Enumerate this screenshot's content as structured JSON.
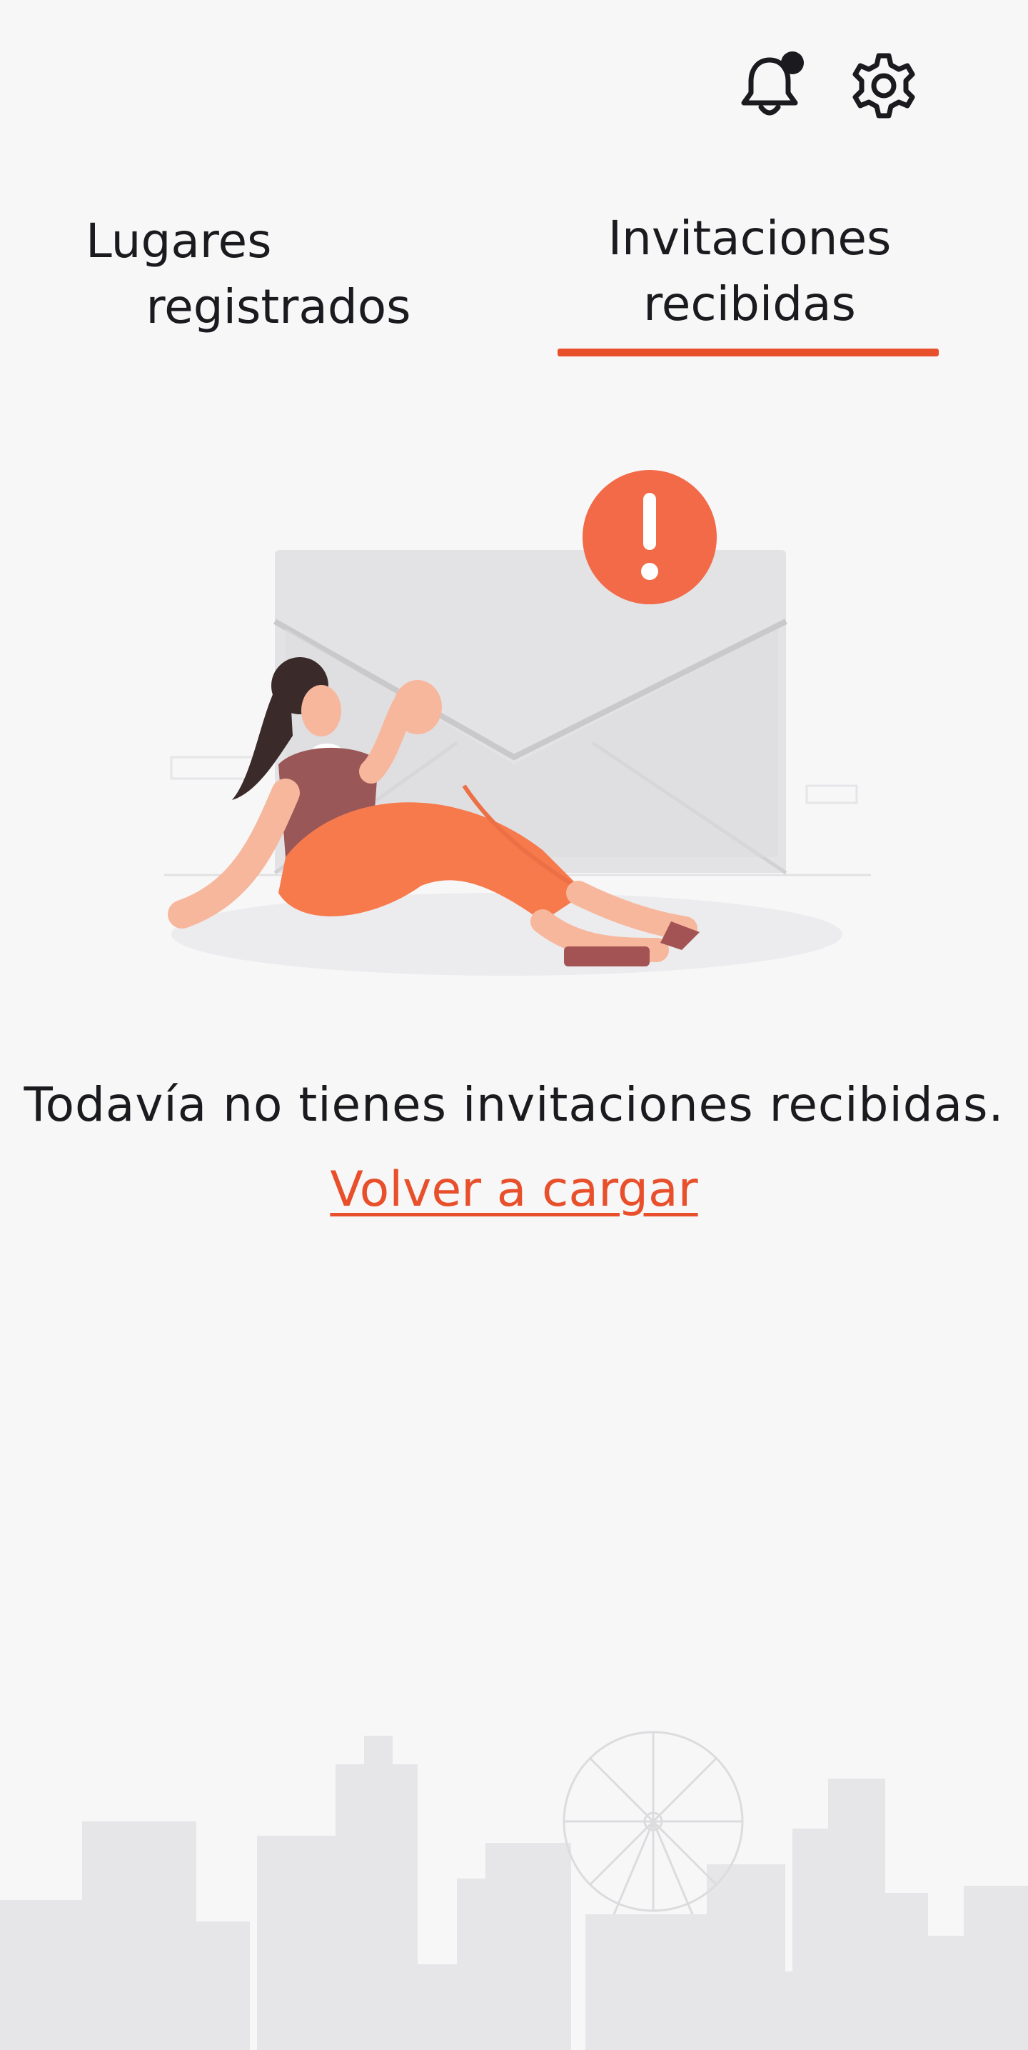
{
  "header": {
    "icons": [
      "notification-bell-icon",
      "gear-icon"
    ],
    "notification_dot": true
  },
  "tabs": [
    {
      "line1": "Lugares",
      "line2": "registrados",
      "active": false
    },
    {
      "line1": "Invitaciones",
      "line2": "recibidas",
      "active": true
    }
  ],
  "empty_state": {
    "illustration": "woman-sitting-with-envelope-alert-illustration",
    "message": "Todavía no tienes invitaciones recibidas.",
    "reload_label": "Volver a cargar"
  },
  "colors": {
    "accent": "#e8502c",
    "text": "#1b1b1f",
    "background": "#f7f7f8"
  }
}
